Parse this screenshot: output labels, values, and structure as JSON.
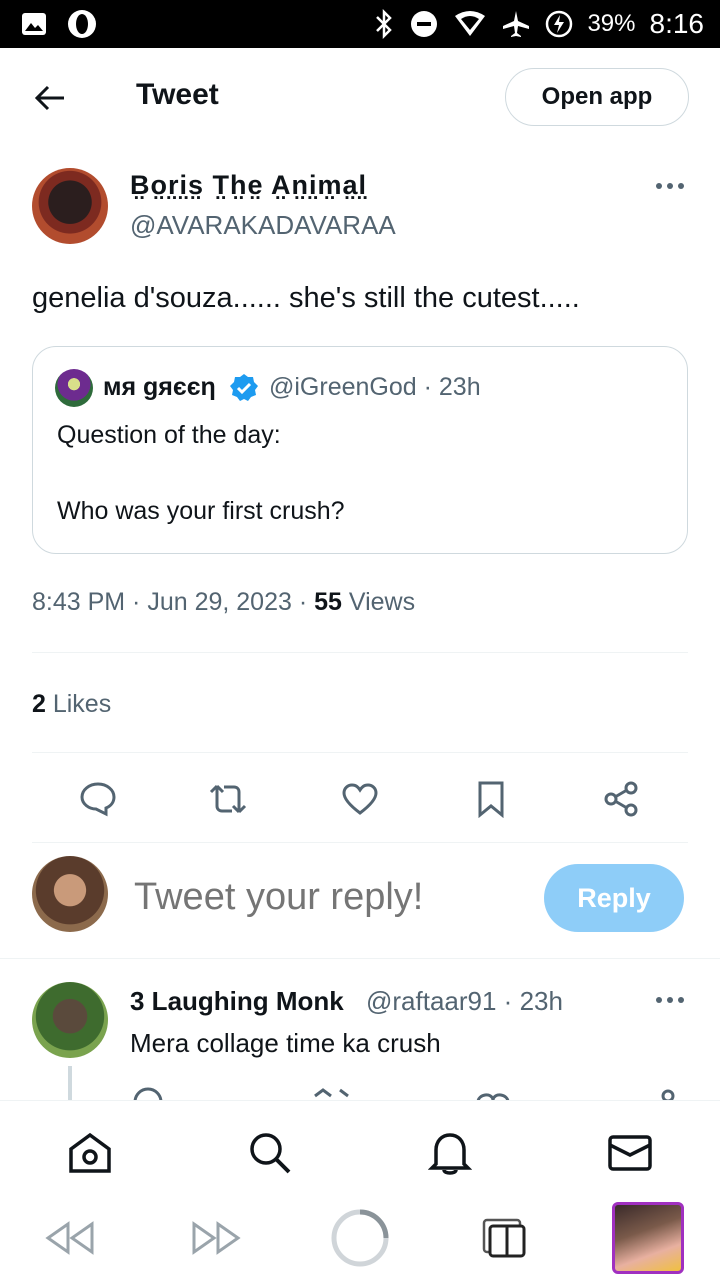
{
  "status_bar": {
    "battery": "39%",
    "time": "8:16",
    "icons": [
      "gallery-icon",
      "opera-icon",
      "bluetooth-icon",
      "dnd-icon",
      "wifi-icon",
      "airplane-icon",
      "battery-charging-icon"
    ]
  },
  "header": {
    "title": "Tweet",
    "open_app_label": "Open app"
  },
  "tweet": {
    "author_name": "B̤o̤r̤i̤s̤ T̤h̤e̤ A̤n̤i̤m̤a̤l̤",
    "author_handle": "@AVARAKADAVARAA",
    "text": "genelia d'souza...... she's still the cutest.....",
    "timestamp": "8:43 PM · Jun 29, 2023 · ",
    "views_count": "55",
    "views_label": " Views",
    "likes_count": "2",
    "likes_label": " Likes"
  },
  "quote": {
    "name": "мя gяєєη",
    "handle": "@iGreenGod · 23h",
    "line1": "Question of the day:",
    "line2": "Who was your first crush?"
  },
  "composer": {
    "placeholder": "Tweet your reply!",
    "reply_label": "Reply"
  },
  "reply": {
    "name": "3 Laughing Monk",
    "handle": "@raftaar91 · 23h",
    "text": "Mera collage time ka crush"
  },
  "colors": {
    "text": "#0f1419",
    "secondary": "#536471",
    "border": "#cfd9de",
    "reply_button": "#8ecdf8",
    "verified": "#1d9bf0"
  }
}
